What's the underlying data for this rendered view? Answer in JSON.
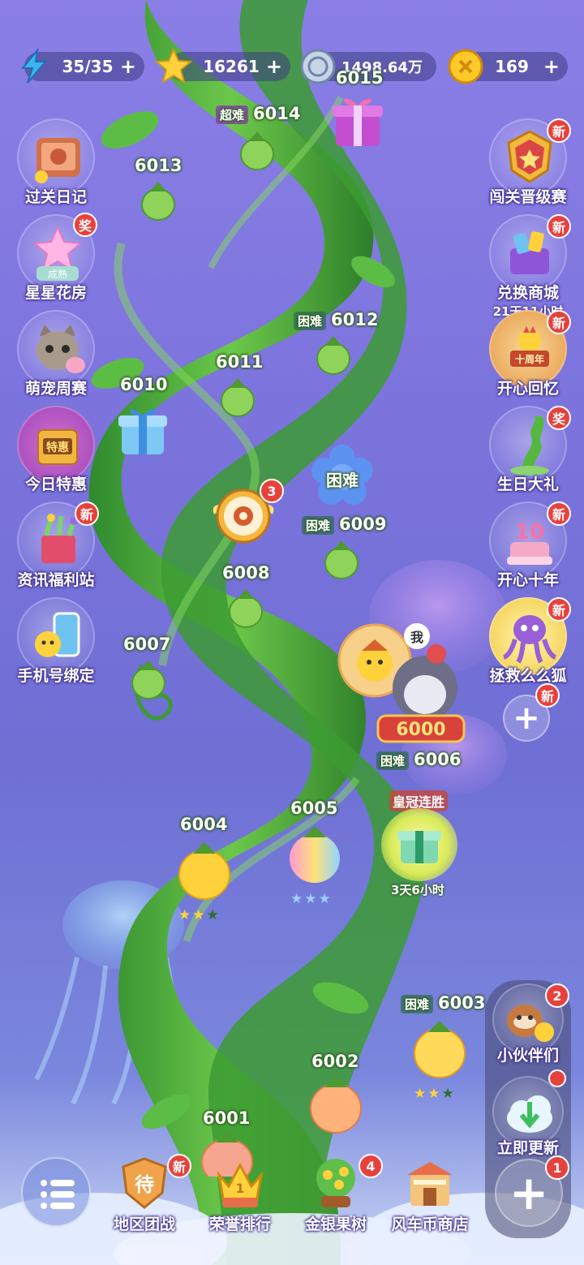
{
  "resources": {
    "energy": "35/35",
    "stars": "16261",
    "coins": "1498.64万",
    "gems": "169",
    "plus": "+"
  },
  "left_menu": [
    {
      "label": "过关日记",
      "icon": "diary-icon"
    },
    {
      "label": "星星花房",
      "icon": "star-flower-house-icon",
      "badge": "奖",
      "sub_tag": "成熟"
    },
    {
      "label": "萌宠周赛",
      "icon": "cat-icon"
    },
    {
      "label": "今日特惠",
      "icon": "shop-icon",
      "inner_text": "特惠"
    },
    {
      "label": "资讯福利站",
      "icon": "gift-bag-icon",
      "badge": "新"
    },
    {
      "label": "手机号绑定",
      "icon": "phone-icon"
    }
  ],
  "right_menu": [
    {
      "label": "闯关晋级赛",
      "icon": "trophy-badge-icon",
      "badge": "新"
    },
    {
      "label": "兑换商城",
      "icon": "exchange-shop-icon",
      "badge": "新",
      "sub": "21天11小时"
    },
    {
      "label": "开心回忆",
      "icon": "memory-icon",
      "badge": "新",
      "inner_text": "十周年"
    },
    {
      "label": "生日大礼",
      "icon": "beanstalk-icon",
      "badge": "奖"
    },
    {
      "label": "开心十年",
      "icon": "cake-icon",
      "badge": "新",
      "inner_text": "10"
    },
    {
      "label": "拯救么么狐",
      "icon": "octopus-icon",
      "badge": "新"
    }
  ],
  "add_button_badge": "新",
  "levels": {
    "l6015": "6015",
    "l6014": "6014",
    "l6013": "6013",
    "l6012": "6012",
    "l6011": "6011",
    "l6010": "6010",
    "l6009": "6009",
    "l6008": "6008",
    "l6007": "6007",
    "l6006": "6006",
    "l6005": "6005",
    "l6004": "6004",
    "l6003": "6003",
    "l6002": "6002",
    "l6001": "6001"
  },
  "tags": {
    "super_hard": "超难",
    "hard": "困难"
  },
  "flower_hard": "困难",
  "wheel_badge": "3",
  "player": {
    "me_label": "我",
    "milestone": "6000"
  },
  "crown_streak": {
    "label": "皇冠连胜",
    "timer": "3天6小时"
  },
  "stars_ratings": {
    "l6004": 2,
    "l6005": 3,
    "l6003": 2
  },
  "right_panel": [
    {
      "label": "小伙伴们",
      "icon": "raccoon-friends-icon",
      "badge": "2"
    },
    {
      "label": "立即更新",
      "icon": "cloud-download-icon",
      "badge": ""
    },
    {
      "label": "",
      "icon": "plus-icon",
      "badge": "1"
    }
  ],
  "bottom_nav": [
    {
      "label": "地区团战",
      "icon": "pending-shield-icon",
      "badge": "新",
      "inner_text": "待"
    },
    {
      "label": "荣誉排行",
      "icon": "crown-icon",
      "badge": "",
      "inner_text": "1"
    },
    {
      "label": "金银果树",
      "icon": "fruit-tree-icon",
      "badge": "4"
    },
    {
      "label": "风车币商店",
      "icon": "windmill-shop-icon",
      "badge": ""
    }
  ],
  "colors": {
    "badge_red": "#e8413d",
    "stalk_green": "#4fae3c",
    "bg_purple": "#7b73dc"
  }
}
